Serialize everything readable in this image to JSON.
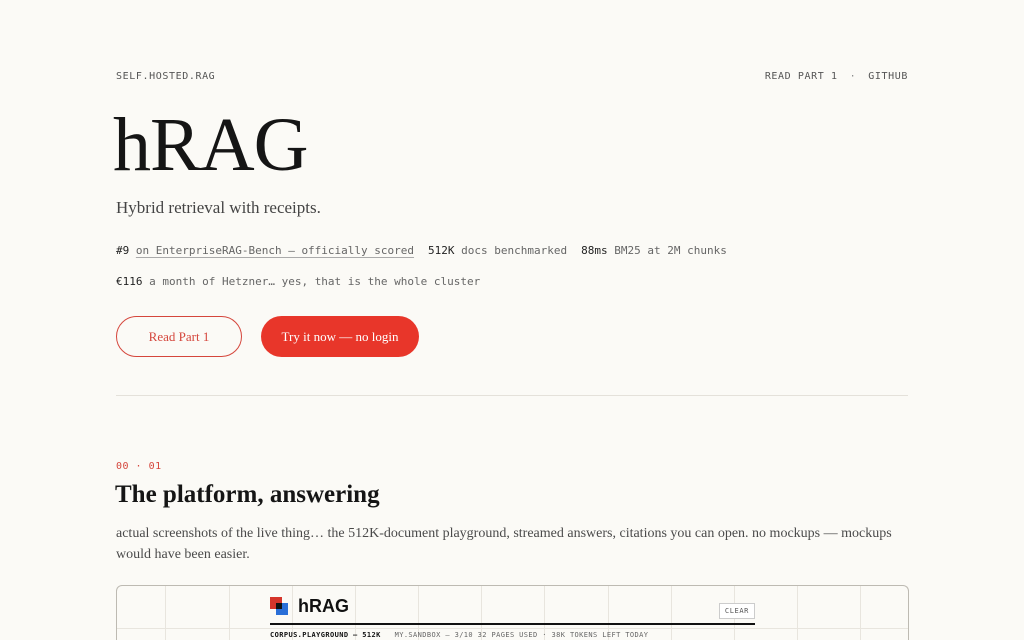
{
  "header": {
    "brand": "SELF.HOSTED.RAG",
    "nav": [
      {
        "label": "READ PART 1 ",
        "icon": "arrow-icon"
      },
      {
        "label": "·"
      },
      {
        "label": "GITHUB"
      }
    ]
  },
  "hero": {
    "title": "hRAG",
    "tagline": "Hybrid retrieval with receipts.",
    "stats_line1": {
      "rank": "#9",
      "rank_link": "on EnterpriseRAG-Bench — officially scored",
      "docs_value": "512K",
      "docs_label": "docs benchmarked",
      "latency_value": "88ms",
      "latency_label": "BM25 at 2M chunks"
    },
    "stats_line2": {
      "cost_value": "€116",
      "cost_label": "a month of Hetzner… yes, that is the whole cluster"
    },
    "buttons": {
      "read_label": "Read Part 1 ",
      "try_label": "Try it now — no login"
    }
  },
  "section": {
    "number": "00 · 01",
    "title": "The platform, answering",
    "description": "actual screenshots of the live thing… the 512K-document playground, streamed answers, citations you can open. no mockups — mockups would have been easier."
  },
  "screenshot": {
    "app_name": "hRAG",
    "clear_label": "CLEAR",
    "corpus": "CORPUS.PLAYGROUND — 512K",
    "meta": "MY.SANDBOX — 3/10   32 PAGES USED · 38K TOKENS LEFT TODAY"
  },
  "colors": {
    "accent": "#e8362a",
    "background": "#fbfaf6",
    "text": "#1a1a1a"
  }
}
